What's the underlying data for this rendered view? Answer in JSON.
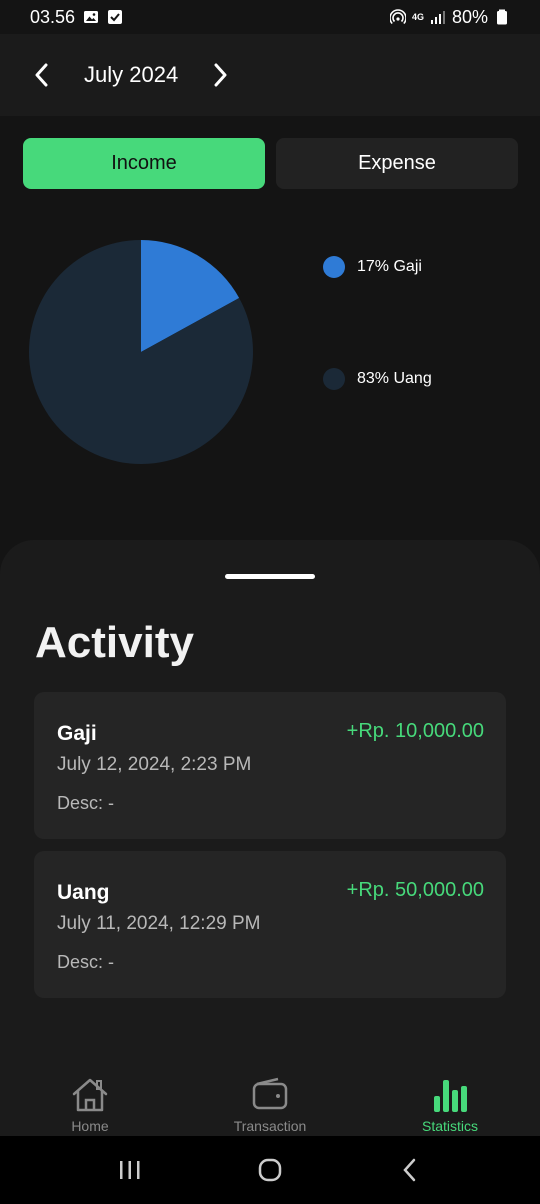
{
  "status_bar": {
    "time": "03.56",
    "network": "4G",
    "battery": "80%"
  },
  "header": {
    "month": "July 2024"
  },
  "toggle": {
    "income_label": "Income",
    "expense_label": "Expense",
    "active": "Income"
  },
  "chart_data": {
    "type": "pie",
    "slices": [
      {
        "label": "Gaji",
        "percent": 17,
        "color": "#2f7bd6",
        "legend": "17% Gaji"
      },
      {
        "label": "Uang",
        "percent": 83,
        "color": "#1b2937",
        "legend": "83% Uang"
      }
    ]
  },
  "activity": {
    "title": "Activity",
    "items": [
      {
        "name": "Gaji",
        "amount": "+Rp. 10,000.00",
        "date": "July 12, 2024, 2:23 PM",
        "desc": "Desc: -"
      },
      {
        "name": "Uang",
        "amount": "+Rp. 50,000.00",
        "date": "July 11, 2024, 12:29 PM",
        "desc": "Desc: -"
      }
    ]
  },
  "bottom_nav": {
    "items": [
      {
        "label": "Home",
        "icon": "home-icon",
        "active": false
      },
      {
        "label": "Transaction",
        "icon": "wallet-icon",
        "active": false
      },
      {
        "label": "Statistics",
        "icon": "bar-chart-icon",
        "active": true
      }
    ],
    "active_color": "#47d97b",
    "inactive_color": "#8a8a8a"
  }
}
